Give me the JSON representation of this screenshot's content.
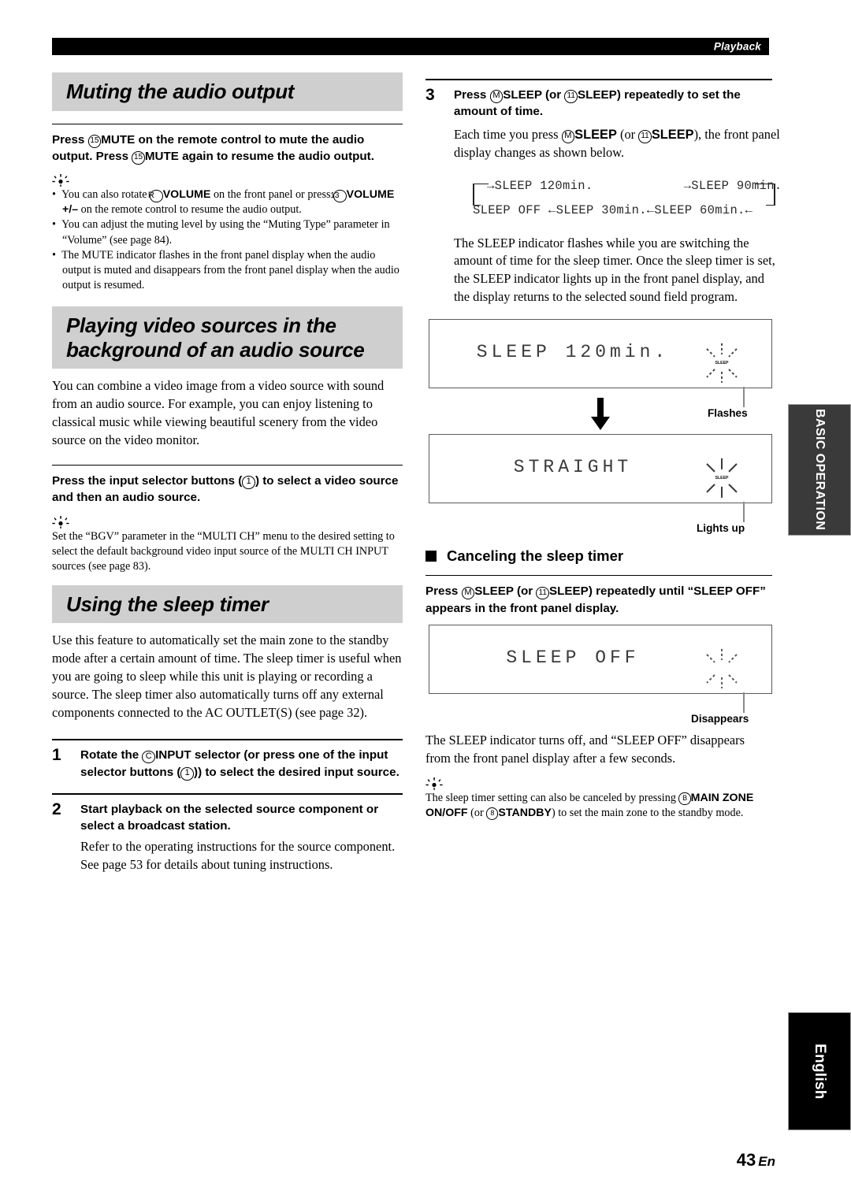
{
  "header": {
    "section_label": "Playback"
  },
  "footer": {
    "page_number": "43",
    "page_suffix": "En"
  },
  "side_tabs": {
    "basic_operation": "BASIC\nOPERATION",
    "basic_line1": "BASIC",
    "basic_line2": "OPERATION",
    "language": "English"
  },
  "left_column": {
    "section1": {
      "heading": "Muting the audio output",
      "instruction_pre": "Press ",
      "instruction_ref1": "15",
      "instruction_mid1": "MUTE",
      "instruction_mid2": " on the remote control to mute the audio output. Press ",
      "instruction_ref2": "15",
      "instruction_mid3": "MUTE",
      "instruction_end": " again to resume the audio output.",
      "tips": [
        {
          "pre": "You can also rotate ",
          "ref1": "R",
          "bold1": "VOLUME",
          "mid": " on the front panel or press ",
          "ref2": "13",
          "bold2": "VOLUME +/–",
          "post": " on the remote control to resume the audio output."
        },
        {
          "text": "You can adjust the muting level by using the “Muting Type” parameter in “Volume” (see page 84)."
        },
        {
          "text": "The MUTE indicator flashes in the front panel display when the audio output is muted and disappears from the front panel display when the audio output is resumed."
        }
      ]
    },
    "section2": {
      "heading_line1": "Playing video sources in the",
      "heading_line2": "background of an audio source",
      "body": "You can combine a video image from a video source with sound from an audio source. For example, you can enjoy listening to classical music while viewing beautiful scenery from the video source on the video monitor.",
      "instruction_pre": "Press the input selector buttons (",
      "instruction_ref": "1",
      "instruction_post": ") to select a video source and then an audio source.",
      "tip": "Set the “BGV” parameter in the “MULTI CH” menu to the desired setting to select the default background video input source of the MULTI CH INPUT sources (see page 83)."
    },
    "section3": {
      "heading": "Using the sleep timer",
      "body": "Use this feature to automatically set the main zone to the standby mode after a certain amount of time. The sleep timer is useful when you are going to sleep while this unit is playing or recording a source. The sleep timer also automatically turns off any external components connected to the AC OUTLET(S) (see page 32).",
      "steps": [
        {
          "number": "1",
          "pre": "Rotate the ",
          "ref1": "C",
          "bold1": "INPUT",
          "mid": " selector (or press one of the input selector buttons (",
          "ref2": "1",
          "post": ")) to select the desired input source."
        },
        {
          "number": "2",
          "title": "Start playback on the selected source component or select a broadcast station.",
          "body_line1": "Refer to the operating instructions for the source component.",
          "body_line2": "See page 53 for details about tuning instructions."
        }
      ]
    }
  },
  "right_column": {
    "step3": {
      "number": "3",
      "pre": "Press ",
      "ref1": "M",
      "bold1": "SLEEP",
      "mid1": " (or ",
      "ref2": "11",
      "bold2": "SLEEP",
      "post1": ") repeatedly to set the amount of time.",
      "sub_pre": "Each time you press ",
      "sub_ref1": "M",
      "sub_bold1": "SLEEP",
      "sub_mid": " (or ",
      "sub_ref2": "11",
      "sub_bold2": "SLEEP",
      "sub_post": "), the front panel display changes as shown below."
    },
    "cycle_diagram": {
      "row_top": "→SLEEP 120min.            →SLEEP 90min.",
      "row_bottom": "SLEEP OFF ←SLEEP 30min.←SLEEP 60min.←",
      "states": [
        "SLEEP 120min.",
        "SLEEP 90min.",
        "SLEEP 60min.",
        "SLEEP 30min.",
        "SLEEP OFF"
      ]
    },
    "explanation": "The SLEEP indicator flashes while you are switching the amount of time for the sleep timer. Once the sleep timer is set, the SLEEP indicator lights up in the front panel display, and the display returns to the selected sound field program.",
    "display_1": {
      "text": "SLEEP 120min.",
      "indicator_label": "SLEEP",
      "callout": "Flashes"
    },
    "display_2": {
      "text": "STRAIGHT",
      "indicator_label": "SLEEP",
      "callout": "Lights up"
    },
    "cancel_section": {
      "heading": "Canceling the sleep timer",
      "instruction_pre": "Press ",
      "instruction_ref1": "M",
      "instruction_bold1": "SLEEP",
      "instruction_mid": " (or ",
      "instruction_ref2": "11",
      "instruction_bold2": "SLEEP",
      "instruction_post": ") repeatedly until “SLEEP OFF” appears in the front panel display.",
      "display_3": {
        "text": "SLEEP OFF",
        "indicator_label": "",
        "callout": "Disappears"
      },
      "body": "The SLEEP indicator turns off, and “SLEEP OFF” disappears from the front panel display after a few seconds.",
      "tip_pre": "The sleep timer setting can also be canceled by pressing ",
      "tip_ref1": "B",
      "tip_bold1": "MAIN ZONE ON/OFF",
      "tip_mid": " (or ",
      "tip_ref2": "8",
      "tip_bold2": "STANDBY",
      "tip_post": ") to set the main zone to the standby mode."
    }
  }
}
